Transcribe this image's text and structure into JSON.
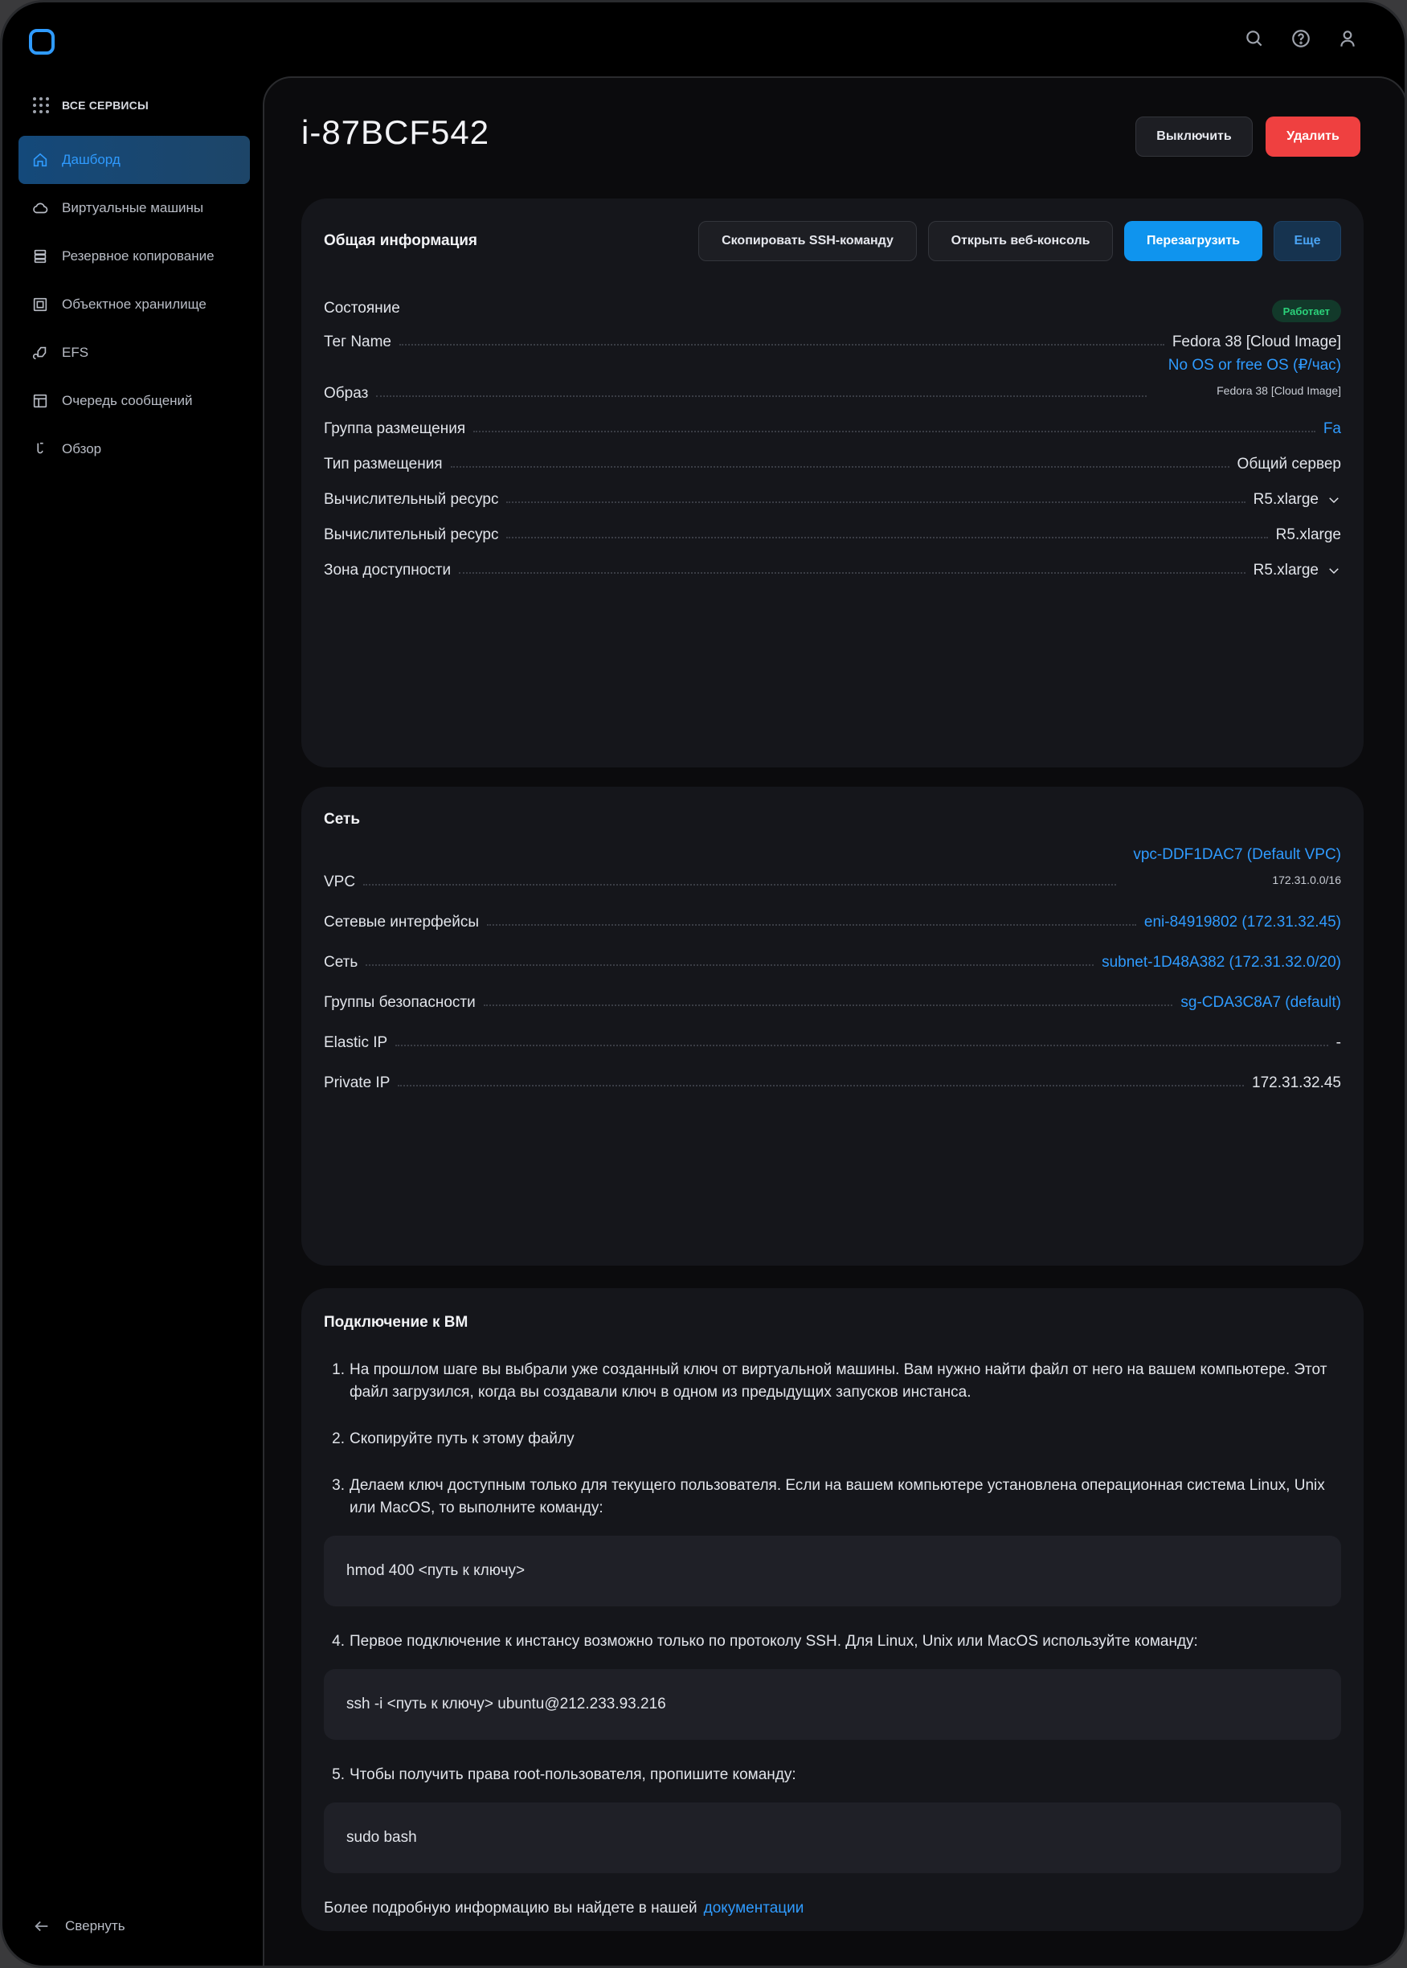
{
  "topbar": {
    "icons": [
      "search-icon",
      "help-icon",
      "user-icon"
    ]
  },
  "sidebar": {
    "all_services": "ВСЕ СЕРВИСЫ",
    "items": [
      {
        "label": "Дашборд",
        "icon": "home-icon",
        "active": true
      },
      {
        "label": "Виртуальные машины",
        "icon": "cloud-icon",
        "active": false
      },
      {
        "label": "Резервное копирование",
        "icon": "database-icon",
        "active": false
      },
      {
        "label": "Объектное хранилище",
        "icon": "storage-icon",
        "active": false
      },
      {
        "label": "EFS",
        "icon": "efs-icon",
        "active": false
      },
      {
        "label": "Очередь сообщений",
        "icon": "queue-icon",
        "active": false
      },
      {
        "label": "Обзор",
        "icon": "overview-icon",
        "active": false
      }
    ],
    "collapse": "Свернуть"
  },
  "page": {
    "title": "i-87BCF542",
    "stop_button": "Выключить",
    "delete_button": "Удалить"
  },
  "general": {
    "title": "Общая информация",
    "copy_ssh": "Скопировать SSH-команду",
    "web_console": "Открыть веб-консоль",
    "reboot": "Перезагрузить",
    "more": "Еще",
    "state_label": "Состояние",
    "state_value": "Работает",
    "tag_label": "Тег Name",
    "tag_value": "Fedora 38 [Cloud Image]",
    "image_label": "Образ",
    "image_value": "No OS or free OS (₽/час)",
    "image_sub": "Fedora 38 [Cloud Image]",
    "placement_group_label": "Группа размещения",
    "placement_group_value": "Fa",
    "placement_type_label": "Тип размещения",
    "placement_type_value": "Общий сервер",
    "compute1_label": "Вычислительный ресурс",
    "compute1_value": "R5.xlarge",
    "compute2_label": "Вычислительный ресурс",
    "compute2_value": "R5.xlarge",
    "zone_label": "Зона доступности",
    "zone_value": "R5.xlarge"
  },
  "network": {
    "title": "Сеть",
    "vpc_label": "VPC",
    "vpc_value": "vpc-DDF1DAC7 (Default VPC)",
    "vpc_sub": "172.31.0.0/16",
    "eni_label": "Сетевые интерфейсы",
    "eni_value": "eni-84919802 (172.31.32.45)",
    "subnet_label": "Сеть",
    "subnet_value": "subnet-1D48A382 (172.31.32.0/20)",
    "sg_label": "Группы безопасности",
    "sg_value": "sg-CDA3C8A7 (default)",
    "eip_label": "Elastic IP",
    "eip_value": "-",
    "pip_label": "Private IP",
    "pip_value": "172.31.32.45"
  },
  "connect": {
    "title": "Подключение к ВМ",
    "step1": "На прошлом шаге вы выбрали уже созданный ключ от виртуальной машины. Вам нужно найти файл от него на вашем компьютере. Этот файл загрузился, когда вы создавали ключ в одном из предыдущих запусков инстанса.",
    "step2": "Скопируйте путь к этому файлу",
    "step3": "Делаем ключ доступным только для текущего пользователя. Если на вашем компьютере установлена операционная система Linux, Unix или MacOS, то выполните команду:",
    "code1": "hmod 400 <путь к ключу>",
    "step4": "Первое подключение к инстансу возможно только по протоколу SSH. Для Linux, Unix или MacOS используйте команду:",
    "code2": "ssh -i <путь к ключу> ubuntu@212.233.93.216",
    "step5": "Чтобы получить права root-пользователя, пропишите команду:",
    "code3": "sudo bash",
    "footer_text": "Более подробную информацию вы найдете в нашей",
    "footer_link": "документации"
  }
}
